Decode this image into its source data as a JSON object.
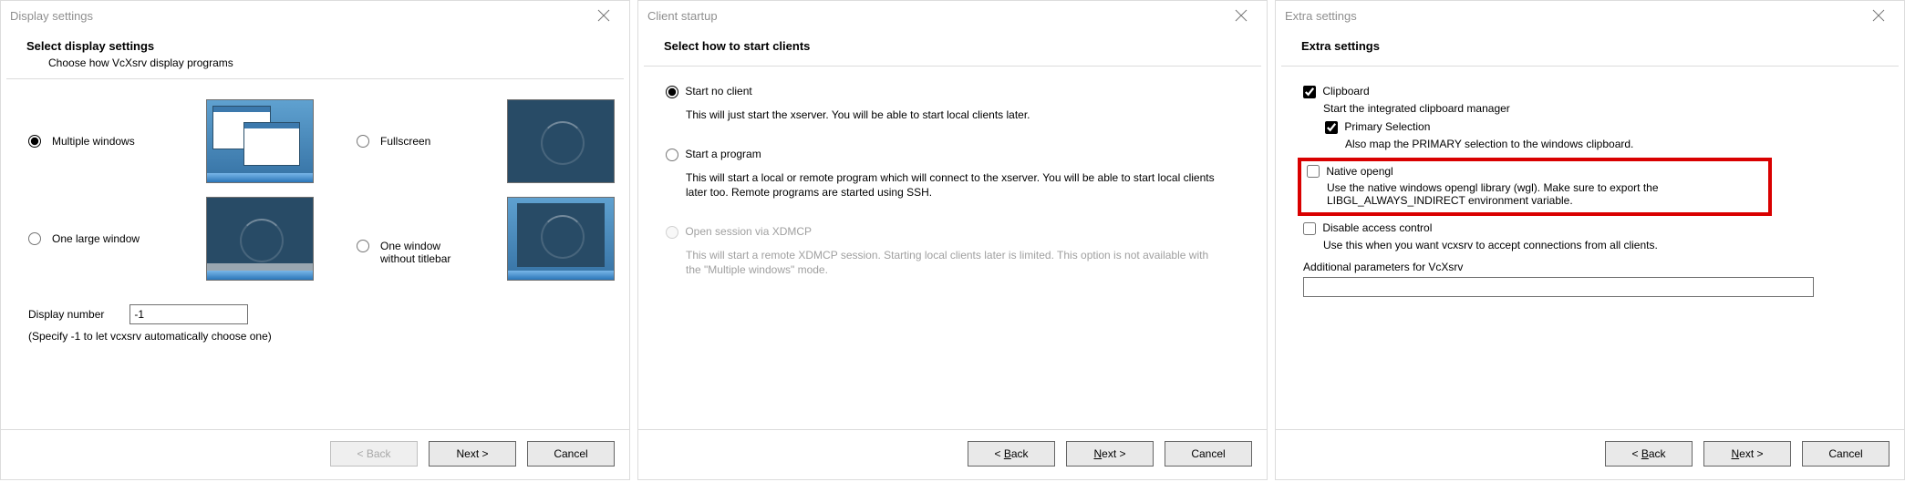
{
  "dialog1": {
    "title": "Display settings",
    "close_icon": "close",
    "heading": "Select display settings",
    "subheading": "Choose how VcXsrv display programs",
    "options": {
      "multiple_windows": "Multiple windows",
      "fullscreen": "Fullscreen",
      "one_large_window": "One large window",
      "one_window_without_titlebar": "One window\nwithout titlebar"
    },
    "selected": "multiple_windows",
    "display_number_label": "Display number",
    "display_number_value": "-1",
    "display_number_hint": "(Specify -1 to let vcxsrv automatically choose one)",
    "buttons": {
      "back": "< Back",
      "next": "Next >",
      "cancel": "Cancel"
    },
    "back_enabled": false
  },
  "dialog2": {
    "title": "Client startup",
    "close_icon": "close",
    "heading": "Select how to start clients",
    "options": [
      {
        "key": "start_no_client",
        "label": "Start no client",
        "desc": "This will just start the xserver. You will be able to start local clients later.",
        "enabled": true
      },
      {
        "key": "start_a_program",
        "label": "Start a program",
        "desc": "This will start a local or remote program which will connect to the xserver. You will be able to start local clients later too. Remote programs are started using SSH.",
        "enabled": true
      },
      {
        "key": "xdmcp",
        "label": "Open session via XDMCP",
        "desc": "This will start a remote XDMCP session. Starting local clients later is limited. This option is not available with the \"Multiple windows\" mode.",
        "enabled": false
      }
    ],
    "selected": "start_no_client",
    "buttons": {
      "back_pre": "< ",
      "back_key": "B",
      "back_post": "ack",
      "next_pre": "",
      "next_key": "N",
      "next_post": "ext >",
      "cancel": "Cancel"
    },
    "back_enabled": true
  },
  "dialog3": {
    "title": "Extra settings",
    "close_icon": "close",
    "heading": "Extra settings",
    "clipboard": {
      "label": "Clipboard",
      "desc": "Start the integrated clipboard manager",
      "checked": true,
      "primary": {
        "label": "Primary Selection",
        "desc": "Also map the PRIMARY selection to the windows clipboard.",
        "checked": true
      }
    },
    "native_opengl": {
      "label": "Native opengl",
      "desc": "Use the native windows opengl library (wgl). Make sure to export the LIBGL_ALWAYS_INDIRECT environment variable.",
      "checked": false,
      "highlighted": true
    },
    "disable_access_control": {
      "label": "Disable access control",
      "desc": "Use this when you want vcxsrv to accept connections from all clients.",
      "checked": false
    },
    "additional_params_label": "Additional parameters for VcXsrv",
    "additional_params_value": "",
    "buttons": {
      "back_pre": "< ",
      "back_key": "B",
      "back_post": "ack",
      "next_pre": "",
      "next_key": "N",
      "next_post": "ext >",
      "cancel": "Cancel"
    },
    "back_enabled": true
  }
}
